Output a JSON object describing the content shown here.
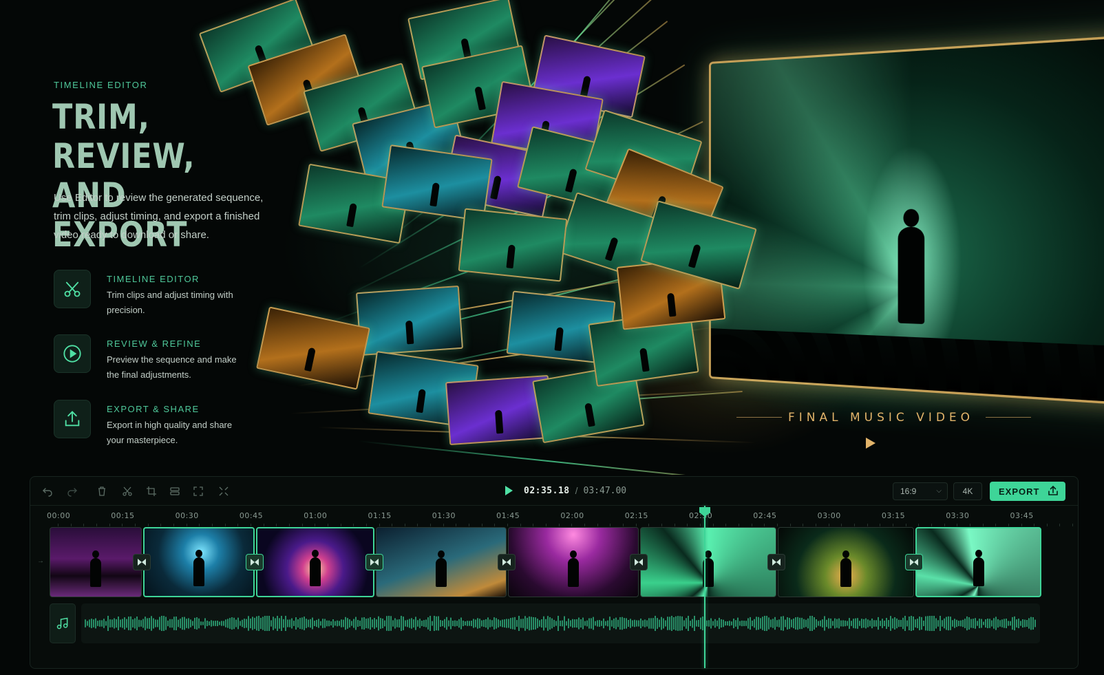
{
  "hero": {
    "eyebrow": "TIMELINE EDITOR",
    "headline": [
      "TRIM, REVIEW,",
      "AND EXPORT"
    ],
    "intro": "Use Editor to review the generated sequence, trim clips, adjust timing, and export a finished video ready to download or share.",
    "features": [
      {
        "icon": "scissors-icon",
        "title": "TIMELINE EDITOR",
        "description": "Trim clips and adjust timing with precision."
      },
      {
        "icon": "play-circle-icon",
        "title": "REVIEW & REFINE",
        "description": "Preview the sequence and make the final adjustments."
      },
      {
        "icon": "upload-icon",
        "title": "EXPORT & SHARE",
        "description": "Export in high quality and share your masterpiece."
      }
    ],
    "final_label": "FINAL MUSIC VIDEO"
  },
  "editor": {
    "toolbar_tools": [
      "undo-icon",
      "redo-icon",
      "trash-icon",
      "scissors-icon",
      "crop-icon",
      "split-icon",
      "expand-icon",
      "shrink-icon"
    ],
    "current_time": "02:35.18",
    "separator": "/",
    "total_time": "03:47.00",
    "aspect_ratio": "16:9",
    "resolution": "4K",
    "export_label": "EXPORT",
    "ruler": [
      "00:00",
      "00:15",
      "00:30",
      "00:45",
      "01:00",
      "01:15",
      "01:30",
      "01:45",
      "02:00",
      "02:15",
      "02:30",
      "02:45",
      "03:00",
      "03:15",
      "03:30",
      "03:45"
    ],
    "clips": [
      {
        "scene": "neon-street",
        "selected": false
      },
      {
        "scene": "silhouette-blue",
        "selected": true
      },
      {
        "scene": "light-tunnel",
        "selected": true
      },
      {
        "scene": "portrait-city",
        "selected": false
      },
      {
        "scene": "pink-stage",
        "selected": false
      },
      {
        "scene": "green-stage",
        "selected": false
      },
      {
        "scene": "crowd-gold",
        "selected": false
      },
      {
        "scene": "finale-stage",
        "selected": true
      }
    ],
    "transitions": 7,
    "playhead_time": "02:35.18",
    "colors": {
      "accent": "#3ed598",
      "gold": "#e2b46a",
      "panel": "#070c0a"
    }
  }
}
